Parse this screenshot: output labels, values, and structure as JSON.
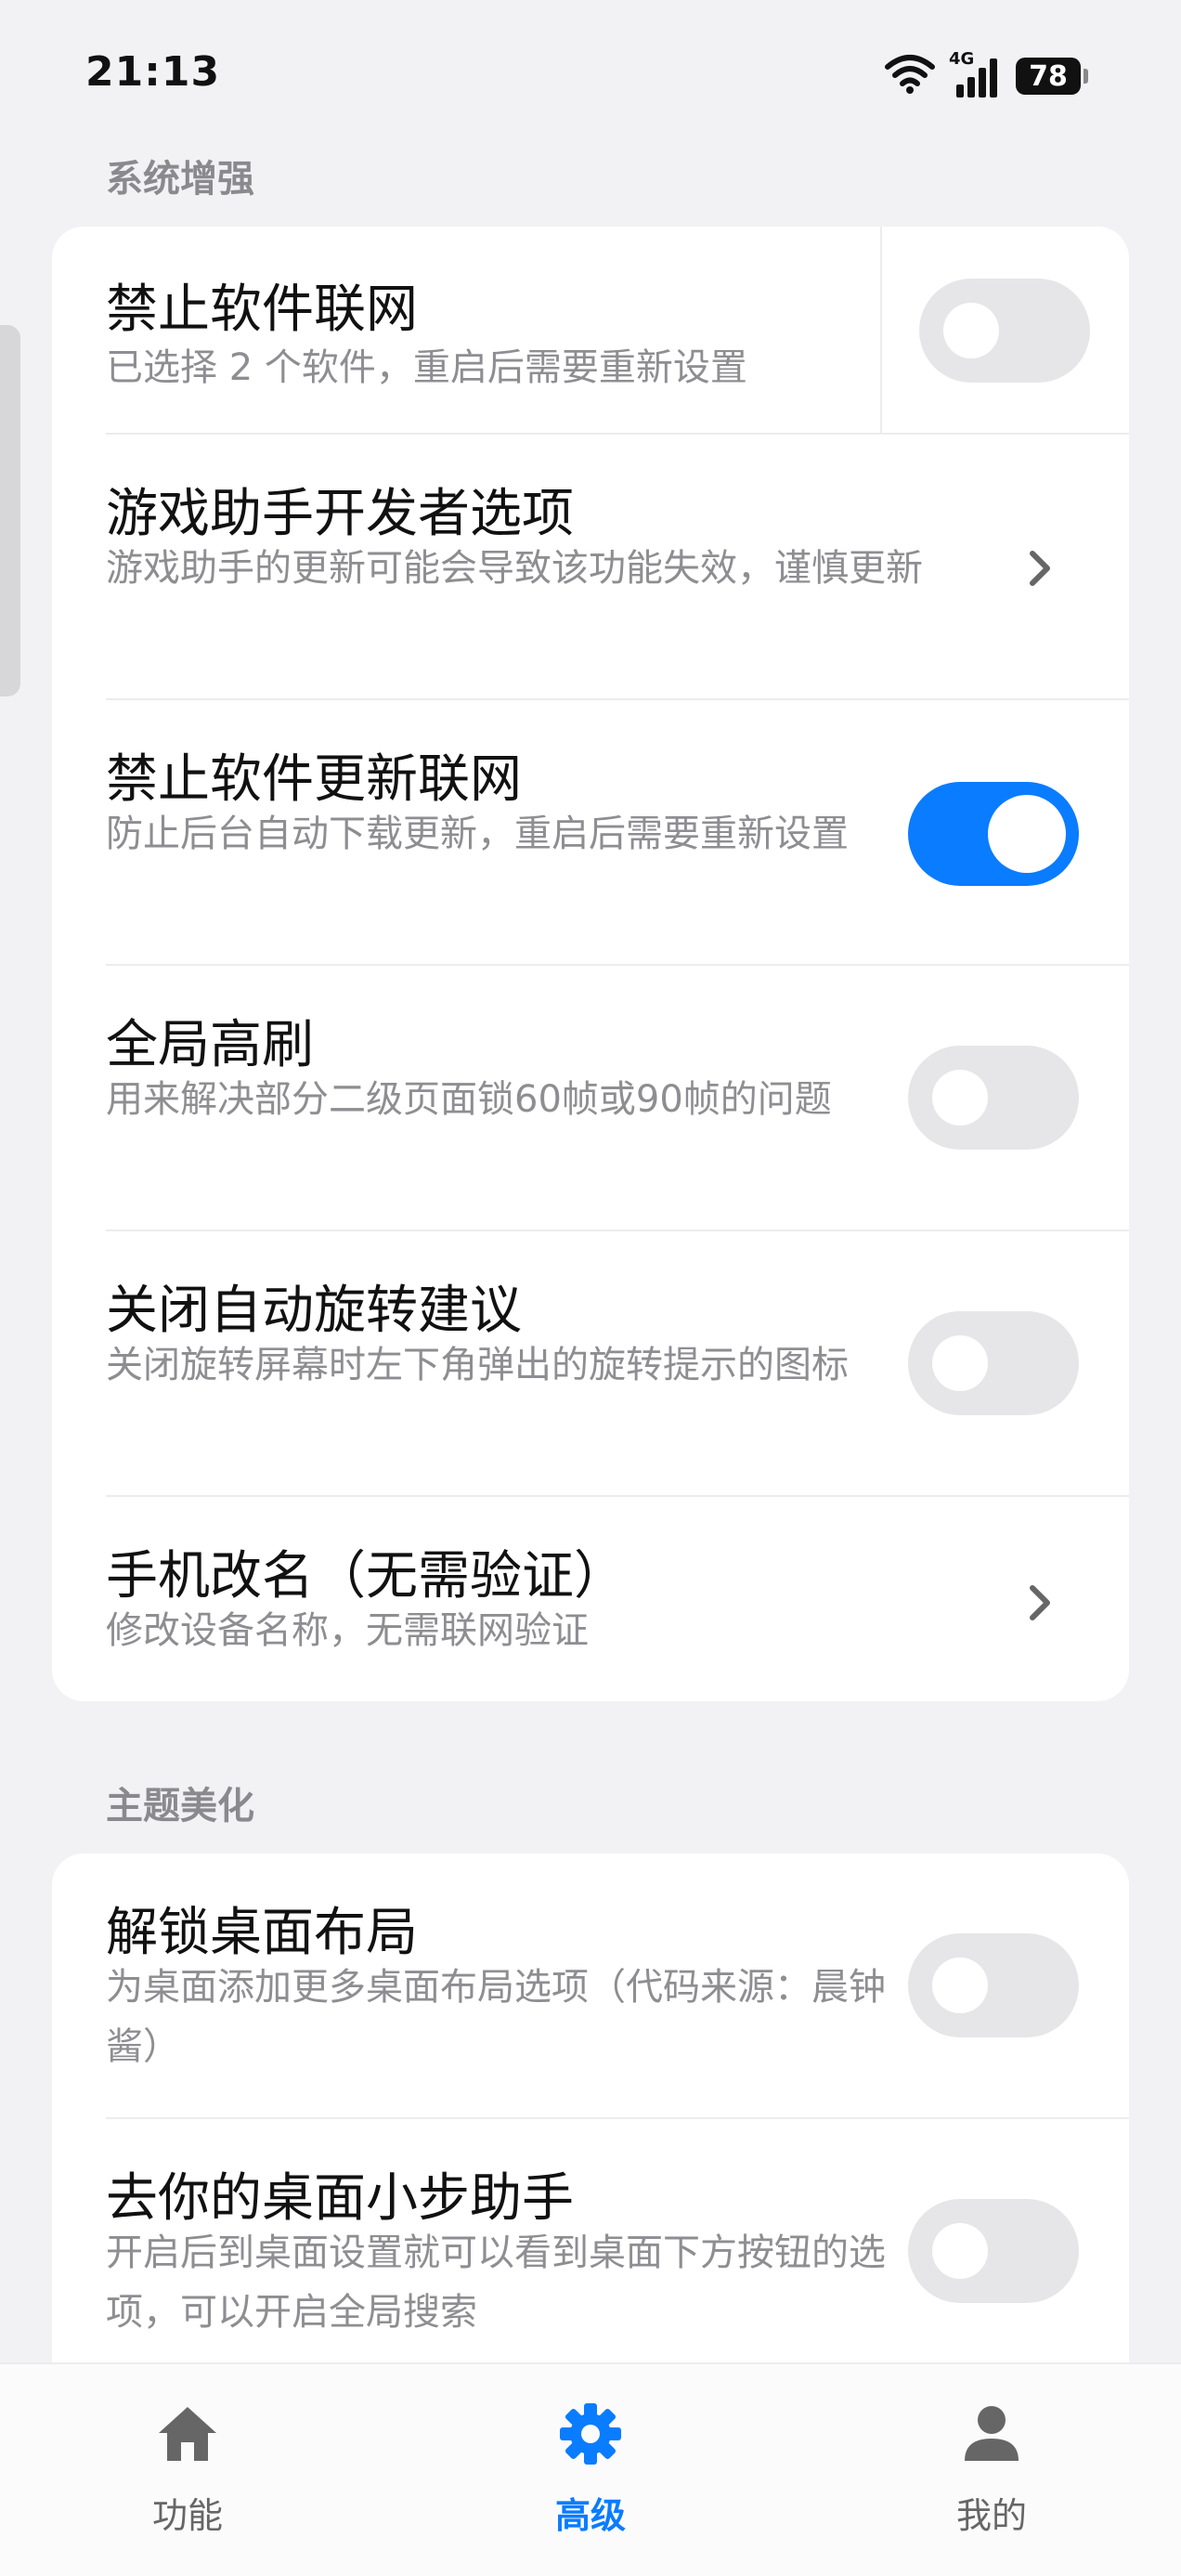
{
  "status_bar": {
    "time": "21:13",
    "network": "4G",
    "battery": "78"
  },
  "sections": [
    {
      "title": "系统增强",
      "items": [
        {
          "title": "禁止软件联网",
          "subtitle": "已选择 2 个软件，重启后需要重新设置",
          "control": "toggle",
          "on": false
        },
        {
          "title": "游戏助手开发者选项",
          "subtitle": "游戏助手的更新可能会导致该功能失效，谨慎更新",
          "control": "chevron"
        },
        {
          "title": "禁止软件更新联网",
          "subtitle": "防止后台自动下载更新，重启后需要重新设置",
          "control": "toggle",
          "on": true
        },
        {
          "title": "全局高刷",
          "subtitle": "用来解决部分二级页面锁60帧或90帧的问题",
          "control": "toggle",
          "on": false
        },
        {
          "title": "关闭自动旋转建议",
          "subtitle": "关闭旋转屏幕时左下角弹出的旋转提示的图标",
          "control": "toggle",
          "on": false
        },
        {
          "title": "手机改名（无需验证）",
          "subtitle": "修改设备名称，无需联网验证",
          "control": "chevron"
        }
      ]
    },
    {
      "title": "主题美化",
      "items": [
        {
          "title": "解锁桌面布局",
          "subtitle": "为桌面添加更多桌面布局选项（代码来源：晨钟酱）",
          "control": "toggle",
          "on": false
        },
        {
          "title": "去你的桌面小步助手",
          "subtitle": "开启后到桌面设置就可以看到桌面下方按钮的选项，可以开启全局搜索",
          "control": "toggle",
          "on": false
        }
      ]
    }
  ],
  "bottom_nav": {
    "items": [
      {
        "label": "功能",
        "icon": "home-icon",
        "active": false
      },
      {
        "label": "高级",
        "icon": "gear-icon",
        "active": true
      },
      {
        "label": "我的",
        "icon": "person-icon",
        "active": false
      }
    ]
  },
  "colors": {
    "accent": "#0a7cff",
    "background": "#f2f2f4",
    "card": "#ffffff",
    "toggle_off": "#e6e6e8",
    "secondary_text": "#8e8e92"
  }
}
